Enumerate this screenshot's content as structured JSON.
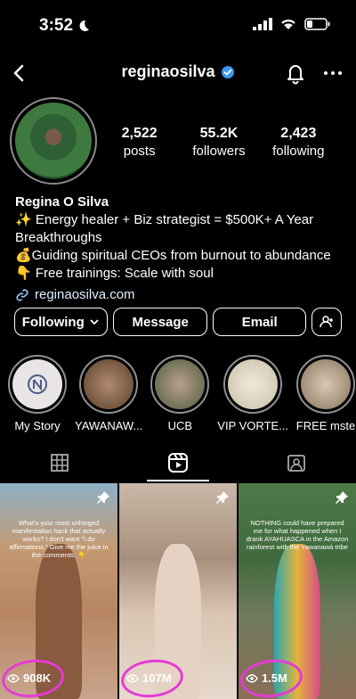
{
  "status": {
    "time": "3:52"
  },
  "header": {
    "username": "reginaosilva"
  },
  "stats": [
    {
      "value": "2,522",
      "label": "posts"
    },
    {
      "value": "55.2K",
      "label": "followers"
    },
    {
      "value": "2,423",
      "label": "following"
    }
  ],
  "bio": {
    "name": "Regina O Silva",
    "line1": "✨ Energy healer + Biz strategist = $500K+ A Year Breakthroughs",
    "line2": "💰Guiding spiritual CEOs from burnout to abundance",
    "line3": "👇 Free trainings: Scale with soul",
    "link": "reginaosilva.com"
  },
  "actions": {
    "following": "Following",
    "message": "Message",
    "email": "Email"
  },
  "highlights": [
    {
      "label": "My Story",
      "color": "#e9e4e6"
    },
    {
      "label": "YAWANAW...",
      "color": "#7a5a45"
    },
    {
      "label": "UCB",
      "color": "#7a6a58"
    },
    {
      "label": "VIP VORTE...",
      "color": "#d9d2c6"
    },
    {
      "label": "FREE mste",
      "color": "#c8b7a0"
    }
  ],
  "reels": [
    {
      "views": "908K",
      "caption": "What's your most unhinged manifestation hack that actually works? I don't want \"I do affirmations.\" Give me the juice in the comments. 👇"
    },
    {
      "views": "107M",
      "caption": ""
    },
    {
      "views": "1.5M",
      "caption": "NOTHING could have prepared me for what happened when I drank AYAHUASCA in the Amazon rainforest with the Yawanawá tribe"
    }
  ]
}
